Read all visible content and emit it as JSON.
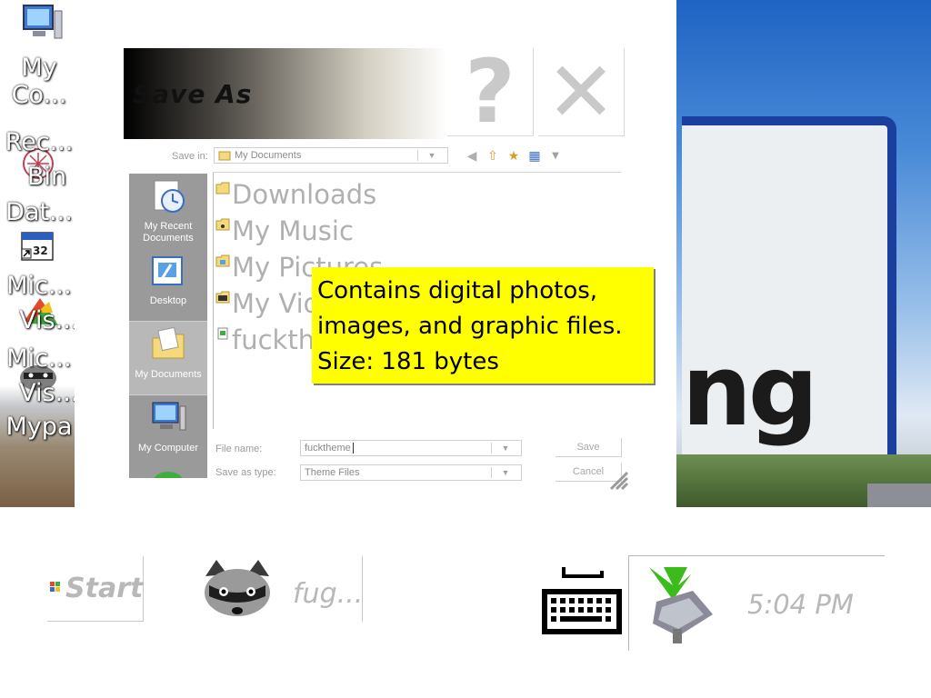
{
  "desktop": {
    "icons": [
      {
        "name": "my-computer",
        "label": "My\nCo..."
      },
      {
        "name": "recycle-bin",
        "label": "Rec...\n  Bin"
      },
      {
        "name": "dat",
        "label": "Dat..."
      },
      {
        "name": "mic-vis-1",
        "label": "Mic...\n  Vis..."
      },
      {
        "name": "mic-vis-2",
        "label": "Mic...\n  Vis..."
      },
      {
        "name": "mypa",
        "label": "Mypa"
      }
    ],
    "sign_text": "ng"
  },
  "dialog": {
    "title": "Save As",
    "help_glyph": "?",
    "close_glyph": "✕",
    "save_in_label": "Save in:",
    "save_in_value": "My Documents",
    "places": [
      {
        "label": "My Recent\nDocuments"
      },
      {
        "label": "Desktop"
      },
      {
        "label": "My Documents"
      },
      {
        "label": "My Computer"
      }
    ],
    "files": [
      {
        "name": "Downloads"
      },
      {
        "name": "My Music"
      },
      {
        "name": "My Pictures"
      },
      {
        "name": "My Videos"
      },
      {
        "name": "fuckthe"
      }
    ],
    "file_name_label": "File name:",
    "file_name_value": "fucktheme",
    "save_type_label": "Save as type:",
    "save_type_value": "Theme Files",
    "save_button": "Save",
    "cancel_button": "Cancel",
    "tooltip": {
      "line1": "Contains digital photos,",
      "line2": "images, and graphic files.",
      "line3": "Size: 181 bytes"
    }
  },
  "taskbar": {
    "start_label": "Start",
    "task_label": "fug...",
    "clock": "5:04 PM"
  },
  "colors": {
    "tooltip_bg": "#ffff00",
    "places_bg": "#9a9a9a",
    "sign_border": "#1b3f9e"
  }
}
